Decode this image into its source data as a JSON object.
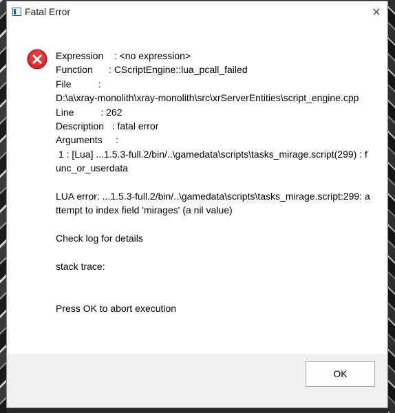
{
  "window": {
    "title": "Fatal Error",
    "close_glyph": "✕"
  },
  "message": {
    "icon": "error-icon",
    "lines": [
      "Expression    : <no expression>",
      "Function      : CScriptEngine::lua_pcall_failed",
      "File          :",
      "D:\\a\\xray-monolith\\xray-monolith\\src\\xrServerEntities\\script_engine.cpp",
      "Line          : 262",
      "Description   : fatal error",
      "Arguments     :",
      " 1 : [Lua] ...1.5.3-full.2/bin/..\\gamedata\\scripts\\tasks_mirage.script(299) : func_or_userdata",
      "",
      "LUA error: ...1.5.3-full.2/bin/..\\gamedata\\scripts\\tasks_mirage.script:299: attempt to index field 'mirages' (a nil value)",
      "",
      "Check log for details",
      "",
      "stack trace:",
      "",
      "",
      "Press OK to abort execution"
    ]
  },
  "footer": {
    "ok_label": "OK"
  },
  "colors": {
    "error_red": "#d9262c",
    "footer_bg": "#f0f0f0"
  }
}
